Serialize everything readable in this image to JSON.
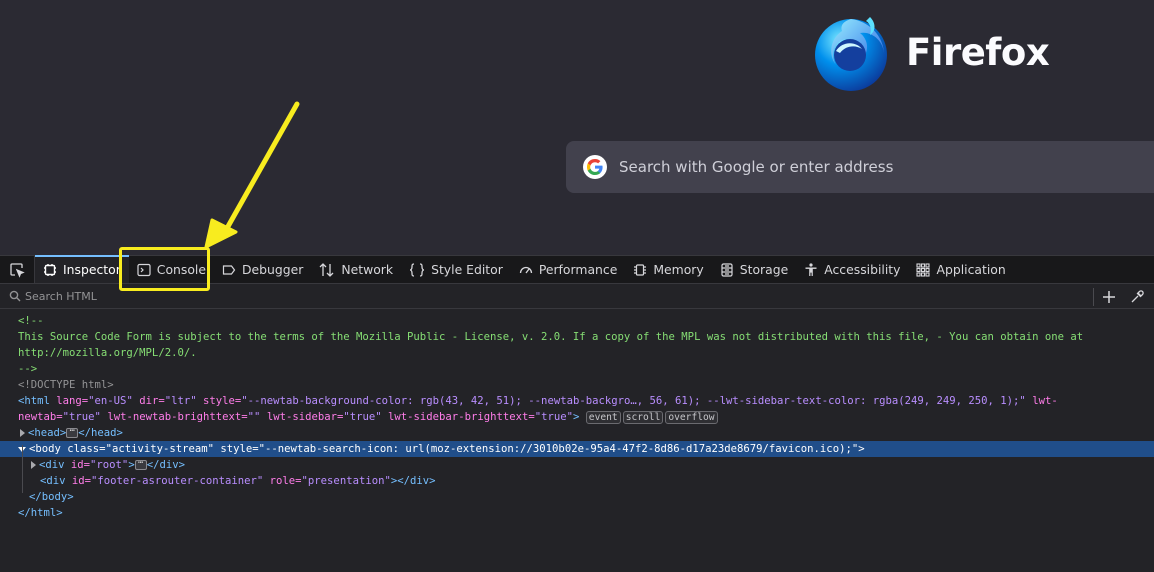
{
  "browser": {
    "brand_name": "Firefox",
    "search_placeholder": "Search with Google or enter address"
  },
  "devtools": {
    "tabs": [
      {
        "label": "Inspector",
        "icon": "inspector-icon",
        "selected": true
      },
      {
        "label": "Console",
        "icon": "console-icon"
      },
      {
        "label": "Debugger",
        "icon": "debugger-icon"
      },
      {
        "label": "Network",
        "icon": "network-icon"
      },
      {
        "label": "Style Editor",
        "icon": "style-editor-icon"
      },
      {
        "label": "Performance",
        "icon": "performance-icon"
      },
      {
        "label": "Memory",
        "icon": "memory-icon"
      },
      {
        "label": "Storage",
        "icon": "storage-icon"
      },
      {
        "label": "Accessibility",
        "icon": "accessibility-icon"
      },
      {
        "label": "Application",
        "icon": "application-icon"
      }
    ],
    "search_placeholder": "Search HTML",
    "markup": {
      "comment_open": "<!--",
      "comment_text": "This Source Code Form is subject to the terms of the Mozilla Public - License, v. 2.0. If a copy of the MPL was not distributed with this file, - You can obtain one at",
      "comment_url": "http://mozilla.org/MPL/2.0/.",
      "comment_close": "-->",
      "doctype": "<!DOCTYPE html>",
      "html_line1": {
        "tag_open": "<html",
        "lang_attr": "lang=",
        "lang_val": "\"en-US\"",
        "dir_attr": "dir=",
        "dir_val": "\"ltr\"",
        "style_attr": "style=",
        "style_val": "\"--newtab-background-color: rgb(43, 42, 51); --newtab-backgro…, 56, 61); --lwt-sidebar-text-color: rgba(249, 249, 250, 1);\"",
        "lwt_attr": "lwt-"
      },
      "html_line2": {
        "lwt_attr": "newtab=",
        "lwt_val": "\"true\"",
        "bt_attr": "lwt-newtab-brighttext=",
        "bt_val": "\"\"",
        "sb_attr": "lwt-sidebar=",
        "sb_val": "\"true\"",
        "sbbt_attr": "lwt-sidebar-brighttext=",
        "sbbt_val": "\"true\"",
        "close": ">",
        "badges": [
          "event",
          "scroll",
          "overflow"
        ]
      },
      "head": {
        "open": "<head>",
        "close": "</head>",
        "collapsed": "⋯"
      },
      "body": {
        "tag_open": "<body",
        "class_attr": "class=",
        "class_val": "\"activity-stream\"",
        "style_attr": "style=",
        "style_val": "\"--newtab-search-icon: url(moz-extension://3010b02e-95a4-47f2-8d86-d17a23de8679/favicon.ico);\"",
        "close": ">"
      },
      "root_div": {
        "open": "<div",
        "id_attr": "id=",
        "id_val": "\"root\"",
        "close": ">",
        "collapsed": "⋯",
        "end": "</div>"
      },
      "footer_div": {
        "open": "<div",
        "id_attr": "id=",
        "id_val": "\"footer-asrouter-container\"",
        "role_attr": "role=",
        "role_val": "\"presentation\"",
        "close": ">",
        "end": "</div>"
      },
      "body_close": "</body>",
      "html_close": "</html>"
    }
  },
  "annotation": {
    "color": "#f8ec1f",
    "target": "Console"
  },
  "colors": {
    "page_bg": "#2b2a33",
    "devtools_bg": "#232327",
    "selection": "#204e8a",
    "accent": "#75bfff"
  }
}
